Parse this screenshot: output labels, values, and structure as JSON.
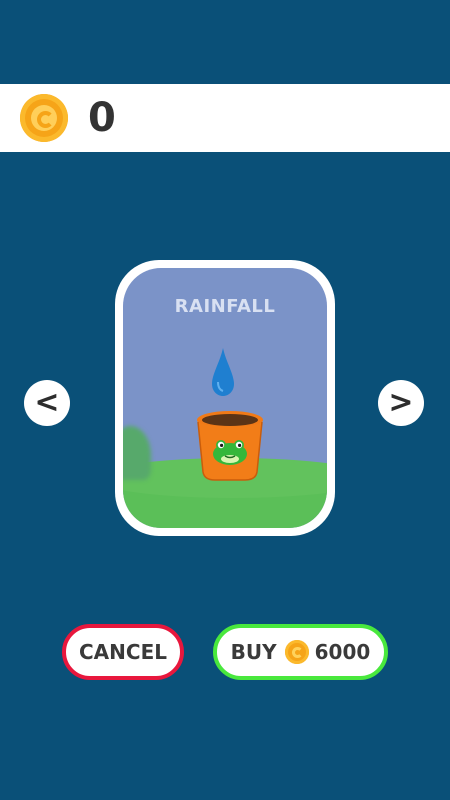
{
  "currency": {
    "icon": "coin-icon",
    "balance": "0",
    "accent_color": "#f6a418"
  },
  "item": {
    "title": "RAINFALL",
    "preview_icons": [
      "water-drop-icon",
      "pot-icon",
      "frog-icon"
    ]
  },
  "navigation": {
    "prev_label": "<",
    "next_label": ">"
  },
  "actions": {
    "cancel_label": "CANCEL",
    "cancel_border_color": "#e8173d",
    "buy_label": "BUY",
    "buy_price": "6000",
    "buy_border_color": "#49e83d"
  }
}
